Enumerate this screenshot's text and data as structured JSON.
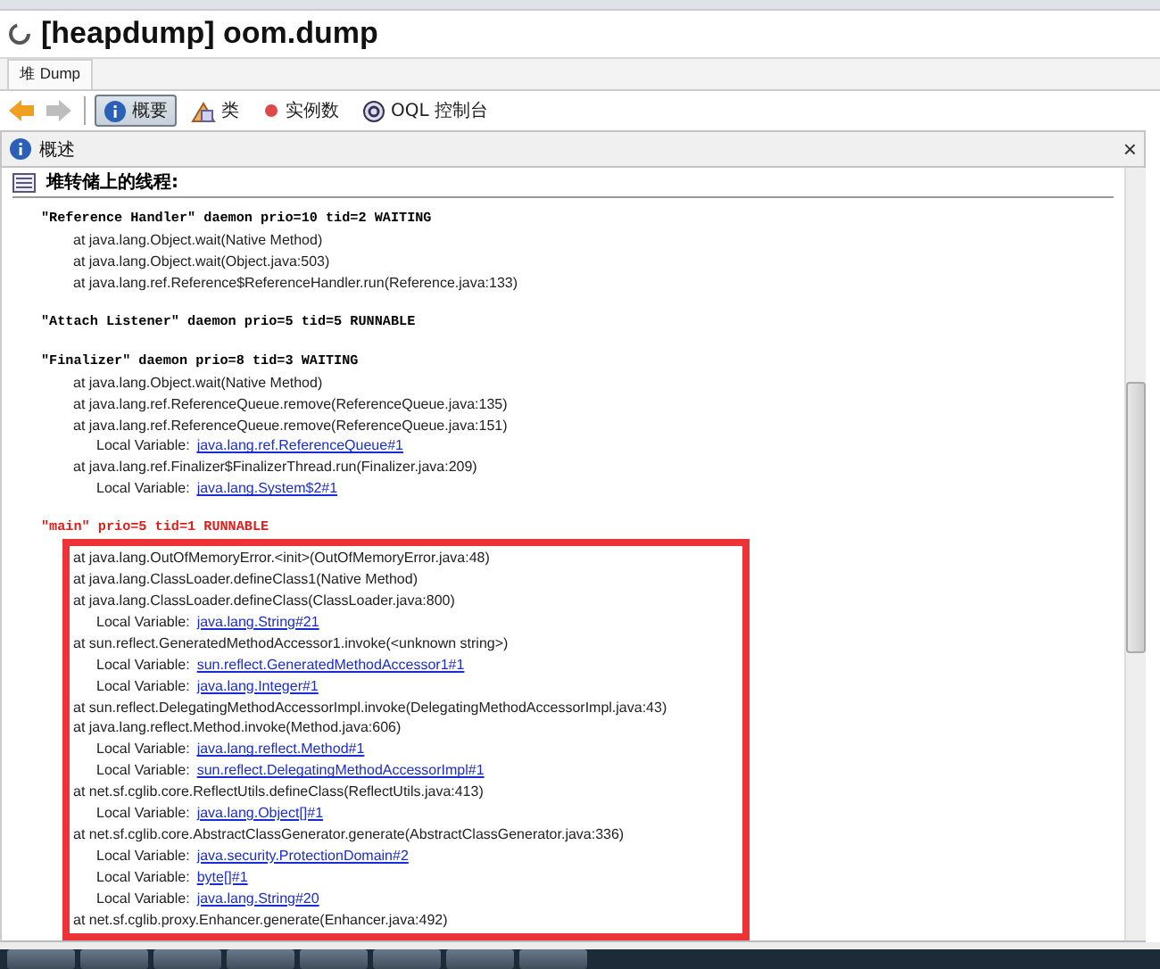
{
  "window": {
    "title": "[heapdump] oom.dump"
  },
  "tabs": [
    {
      "label": "堆 Dump",
      "selected": true
    }
  ],
  "toolbar": {
    "nav": [
      {
        "kind": "back",
        "disabled": false
      },
      {
        "kind": "forward",
        "disabled": true
      }
    ],
    "items": [
      {
        "kind": "summary",
        "label": "概要",
        "selected": true
      },
      {
        "kind": "classes",
        "label": "类",
        "selected": false
      },
      {
        "kind": "instances",
        "label": "实例数",
        "selected": false
      },
      {
        "kind": "oql",
        "label": "OQL 控制台",
        "selected": false
      }
    ]
  },
  "panel": {
    "title": "概述",
    "close": "×",
    "section": "堆转储上的线程:",
    "threads": [
      {
        "header": "\"Reference Handler\" daemon prio=10 tid=2 WAITING",
        "color": "#000000",
        "lines": [
          {
            "kind": "frame",
            "text": "at java.lang.Object.wait(Native Method)"
          },
          {
            "kind": "frame",
            "text": "at java.lang.Object.wait(Object.java:503)"
          },
          {
            "kind": "frame",
            "text": "at java.lang.ref.Reference$ReferenceHandler.run(Reference.java:133)"
          }
        ]
      },
      {
        "header": "\"Attach Listener\" daemon prio=5 tid=5 RUNNABLE",
        "color": "#000000"
      },
      {
        "header": "\"Finalizer\" daemon prio=8 tid=3 WAITING",
        "color": "#000000",
        "lines": [
          {
            "kind": "frame",
            "text": "at java.lang.Object.wait(Native Method)"
          },
          {
            "kind": "frame",
            "text": "at java.lang.ref.ReferenceQueue.remove(ReferenceQueue.java:135)"
          },
          {
            "kind": "frame",
            "text": "at java.lang.ref.ReferenceQueue.remove(ReferenceQueue.java:151)"
          },
          {
            "kind": "local",
            "label": "Local Variable:",
            "link": "java.lang.ref.ReferenceQueue#1"
          },
          {
            "kind": "frame",
            "text": "at java.lang.ref.Finalizer$FinalizerThread.run(Finalizer.java:209)"
          },
          {
            "kind": "local",
            "label": "Local Variable:",
            "link": "java.lang.System$2#1"
          }
        ]
      },
      {
        "header": "\"main\" prio=5 tid=1 RUNNABLE",
        "color": "#e0201c",
        "highlighted": true,
        "lines": [
          {
            "kind": "frame",
            "text": "at java.lang.OutOfMemoryError.<init>(OutOfMemoryError.java:48)"
          },
          {
            "kind": "frame",
            "text": "at java.lang.ClassLoader.defineClass1(Native Method)"
          },
          {
            "kind": "frame",
            "text": "at java.lang.ClassLoader.defineClass(ClassLoader.java:800)"
          },
          {
            "kind": "local",
            "label": "Local Variable:",
            "link": "java.lang.String#21"
          },
          {
            "kind": "frame",
            "text": "at sun.reflect.GeneratedMethodAccessor1.invoke(<unknown string>)"
          },
          {
            "kind": "local",
            "label": "Local Variable:",
            "link": "sun.reflect.GeneratedMethodAccessor1#1"
          },
          {
            "kind": "local",
            "label": "Local Variable:",
            "link": "java.lang.Integer#1"
          },
          {
            "kind": "frame",
            "text": "at sun.reflect.DelegatingMethodAccessorImpl.invoke(DelegatingMethodAccessorImpl.java:43)"
          },
          {
            "kind": "frame",
            "text": "at java.lang.reflect.Method.invoke(Method.java:606)"
          },
          {
            "kind": "local",
            "label": "Local Variable:",
            "link": "java.lang.reflect.Method#1"
          },
          {
            "kind": "local",
            "label": "Local Variable:",
            "link": "sun.reflect.DelegatingMethodAccessorImpl#1"
          },
          {
            "kind": "frame",
            "text": "at net.sf.cglib.core.ReflectUtils.defineClass(ReflectUtils.java:413)"
          },
          {
            "kind": "local",
            "label": "Local Variable:",
            "link": "java.lang.Object[]#1"
          },
          {
            "kind": "frame",
            "text": "at net.sf.cglib.core.AbstractClassGenerator.generate(AbstractClassGenerator.java:336)"
          },
          {
            "kind": "local",
            "label": "Local Variable:",
            "link": "java.security.ProtectionDomain#2"
          },
          {
            "kind": "local",
            "label": "Local Variable:",
            "link": "byte[]#1"
          },
          {
            "kind": "local",
            "label": "Local Variable:",
            "link": "java.lang.String#20"
          },
          {
            "kind": "frame",
            "text": "at net.sf.cglib.proxy.Enhancer.generate(Enhancer.java:492)"
          }
        ]
      }
    ]
  }
}
